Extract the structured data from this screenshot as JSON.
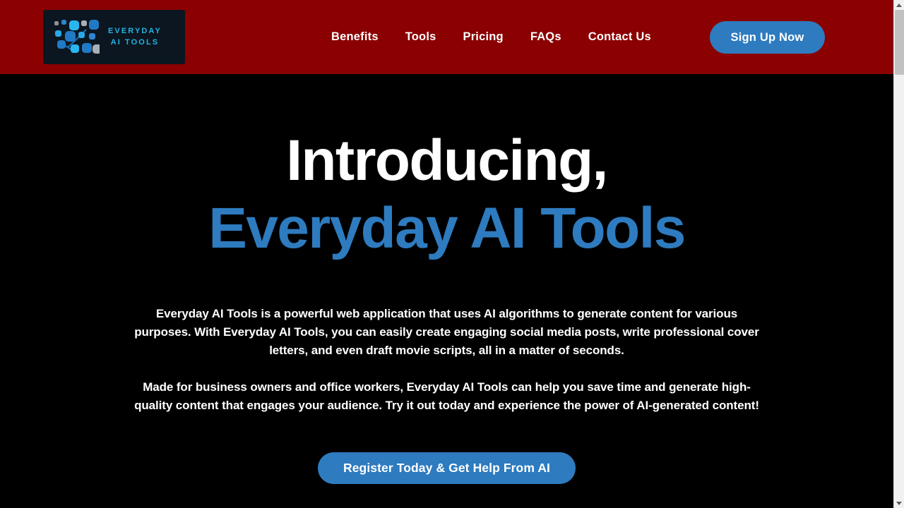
{
  "page": {
    "background_color": "#000000",
    "accent_blue": "#2E7BBF",
    "header_red": "#8B0000",
    "logo_navy": "#0B1620",
    "logo_cyan": "#24B3E3"
  },
  "header": {
    "logo": {
      "icon_name": "ai-network-nodes-icon",
      "line1": "EVERYDAY",
      "line2": "AI TOOLS"
    },
    "nav": [
      {
        "label": "Benefits"
      },
      {
        "label": "Tools"
      },
      {
        "label": "Pricing"
      },
      {
        "label": "FAQs"
      },
      {
        "label": "Contact Us"
      }
    ],
    "signup_label": "Sign Up Now"
  },
  "hero": {
    "title_line1": "Introducing,",
    "title_line2": "Everyday AI Tools",
    "paragraph1": "Everyday AI Tools is a powerful web application that uses AI algorithms to generate content for various purposes. With Everyday AI Tools, you can easily create engaging social media posts, write professional cover letters, and even draft movie scripts, all in a matter of seconds.",
    "paragraph2": "Made for business owners and office workers, Everyday AI Tools can help you save time and generate high-quality content that engages your audience. Try it out today and experience the power of AI-generated content!",
    "cta_label": "Register Today & Get Help From AI"
  },
  "scrollbar": {
    "up_arrow_icon": "scroll-up-arrow-icon",
    "down_arrow_icon": "scroll-down-arrow-icon"
  }
}
